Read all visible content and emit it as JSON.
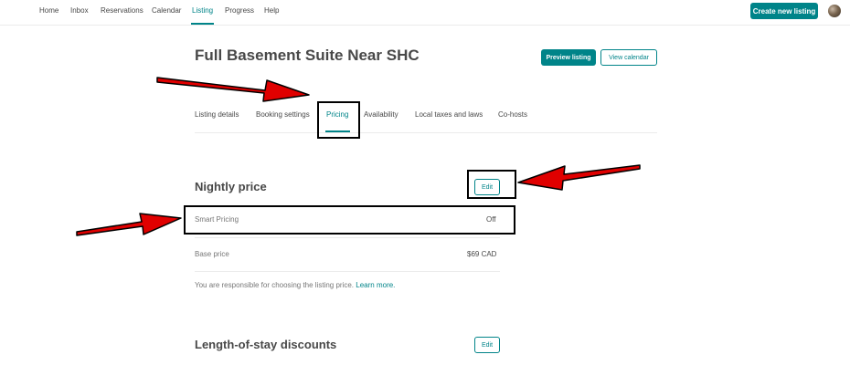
{
  "nav": {
    "items": [
      {
        "label": "Home"
      },
      {
        "label": "Inbox"
      },
      {
        "label": "Reservations"
      },
      {
        "label": "Calendar"
      },
      {
        "label": "Listing"
      },
      {
        "label": "Progress"
      },
      {
        "label": "Help"
      }
    ],
    "active": "Listing",
    "create_label": "Create new listing"
  },
  "listing": {
    "title": "Full Basement Suite Near SHC",
    "preview_label": "Preview listing",
    "calendar_label": "View calendar"
  },
  "tabs": {
    "items": [
      {
        "label": "Listing details"
      },
      {
        "label": "Booking settings"
      },
      {
        "label": "Pricing"
      },
      {
        "label": "Availability"
      },
      {
        "label": "Local taxes and laws"
      },
      {
        "label": "Co-hosts"
      }
    ],
    "active": "Pricing"
  },
  "nightly": {
    "title": "Nightly price",
    "edit_label": "Edit",
    "smart_pricing_label": "Smart Pricing",
    "smart_pricing_value": "Off",
    "base_price_label": "Base price",
    "base_price_value": "$69 CAD",
    "note_text": "You are responsible for choosing the listing price.",
    "note_link": "Learn more."
  },
  "los": {
    "title": "Length-of-stay discounts",
    "edit_label": "Edit"
  },
  "colors": {
    "accent": "#008489",
    "annotation_arrow": "#e00000",
    "annotation_box": "#000000"
  }
}
